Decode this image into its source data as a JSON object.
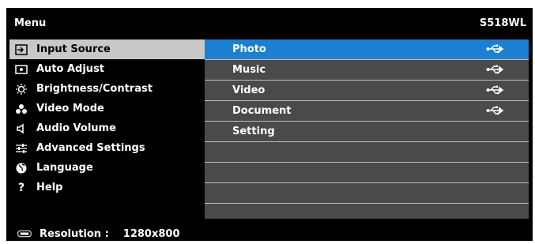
{
  "header": {
    "title": "Menu",
    "model": "S518WL"
  },
  "menu": {
    "items": [
      {
        "label": "Input Source",
        "icon": "input-source-icon"
      },
      {
        "label": "Auto Adjust",
        "icon": "auto-adjust-icon"
      },
      {
        "label": "Brightness/Contrast",
        "icon": "brightness-icon"
      },
      {
        "label": "Video Mode",
        "icon": "video-mode-icon"
      },
      {
        "label": "Audio Volume",
        "icon": "speaker-icon"
      },
      {
        "label": "Advanced Settings",
        "icon": "settings-sliders-icon"
      },
      {
        "label": "Language",
        "icon": "globe-icon"
      },
      {
        "label": "Help",
        "icon": "help-icon"
      }
    ],
    "selected_index": 0
  },
  "submenu": {
    "items": [
      {
        "label": "Photo",
        "has_usb": true
      },
      {
        "label": "Music",
        "has_usb": true
      },
      {
        "label": "Video",
        "has_usb": true
      },
      {
        "label": "Document",
        "has_usb": true
      },
      {
        "label": "Setting",
        "has_usb": false
      }
    ],
    "active_index": 0,
    "empty_rows": 3
  },
  "footer": {
    "label": "Resolution :",
    "value": "1280x800"
  },
  "colors": {
    "active_row": "#1c7fcf",
    "selected_menu": "#c8c8c8",
    "submenu_bg": "#4a4a4a"
  }
}
